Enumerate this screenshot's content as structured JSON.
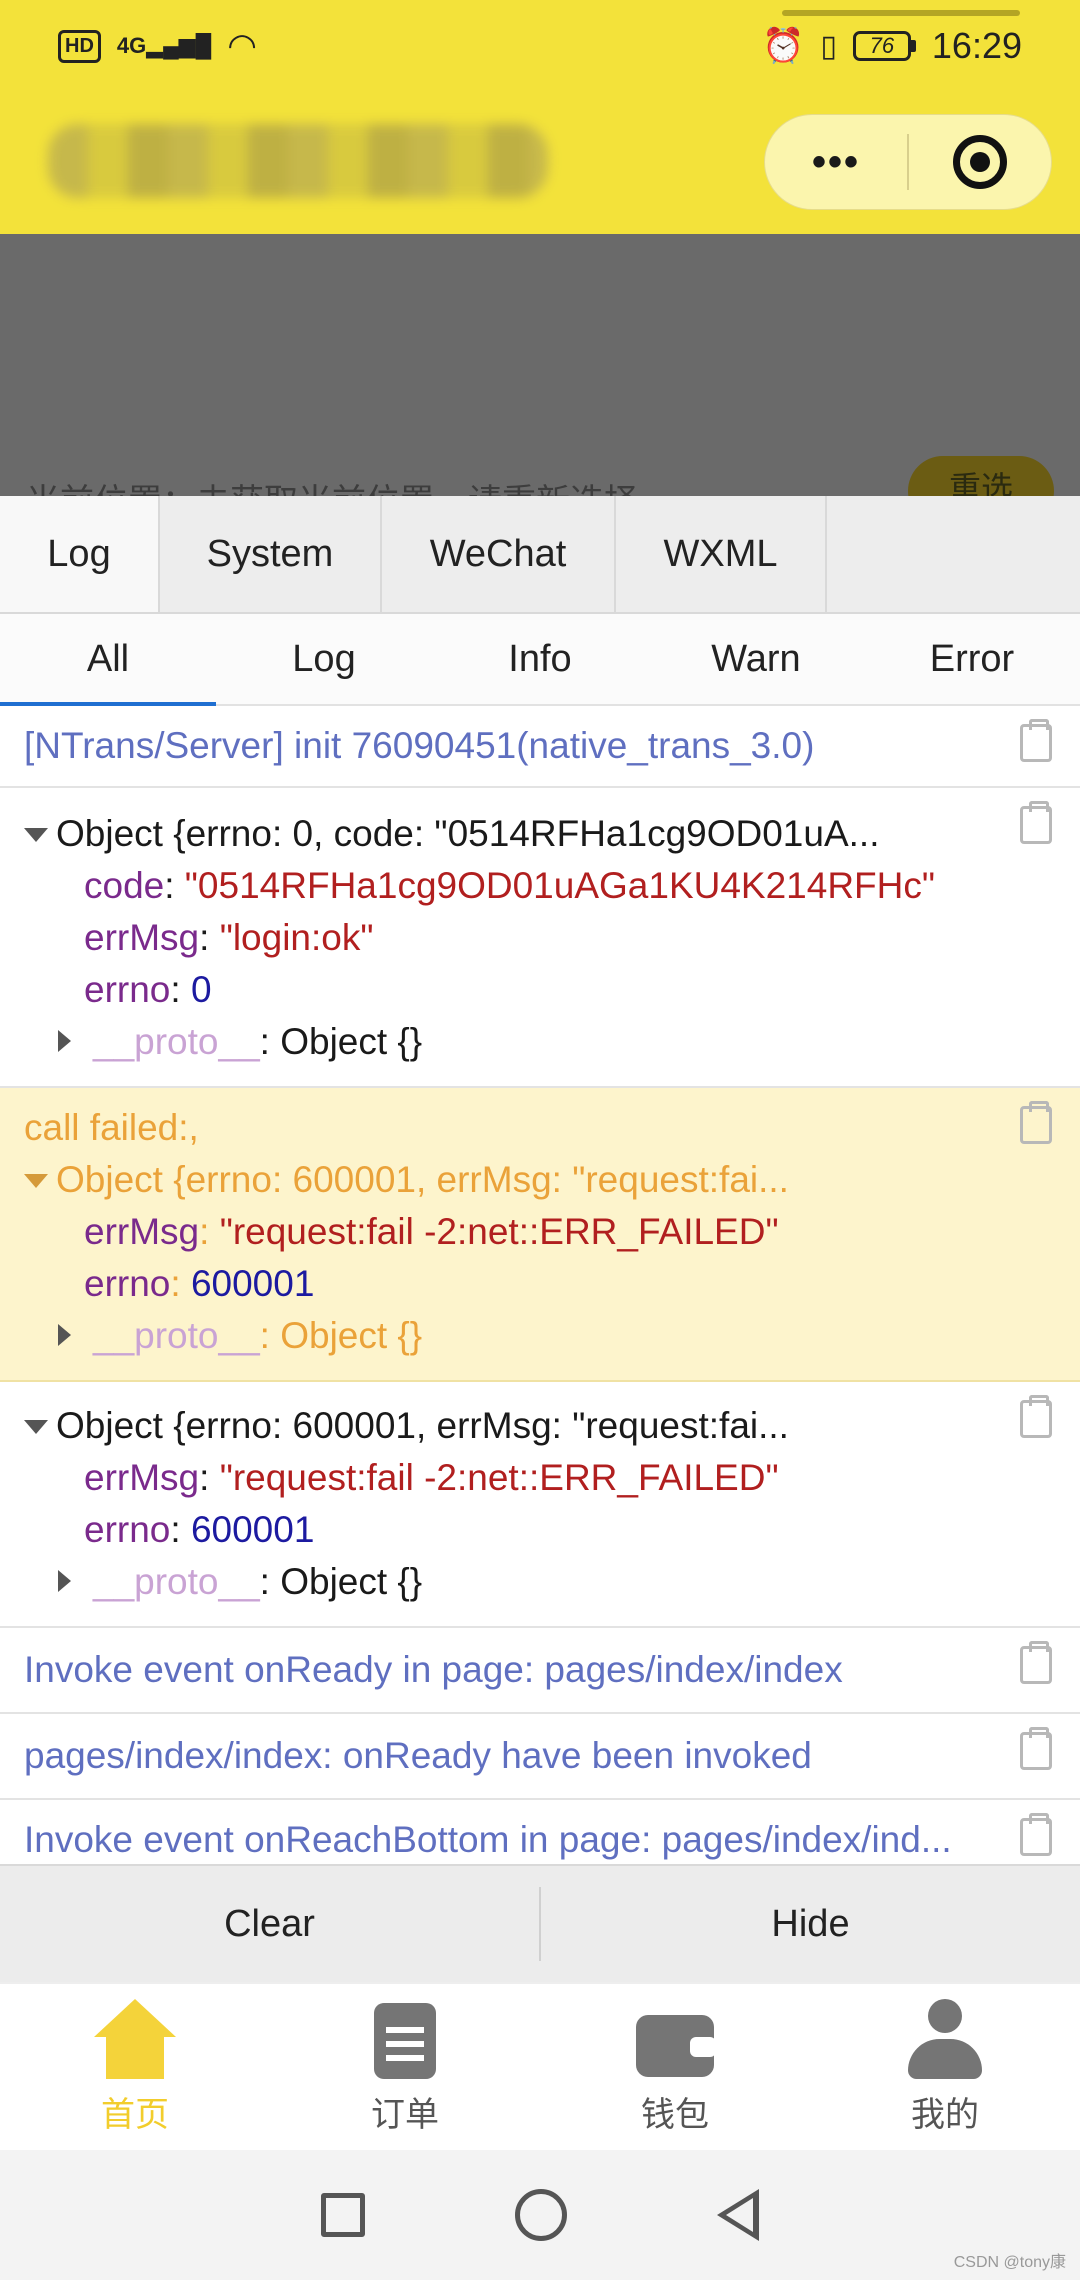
{
  "status_bar": {
    "hd": "HD",
    "network": "4G",
    "battery": "76",
    "time": "16:29"
  },
  "header": {
    "more_label": "•••"
  },
  "page": {
    "location_text": "当前位置：未获取当前位置，请重新选择",
    "reselect_label": "重选"
  },
  "console": {
    "top_tabs": [
      "Log",
      "System",
      "WeChat",
      "WXML"
    ],
    "sub_tabs": [
      "All",
      "Log",
      "Info",
      "Warn",
      "Error"
    ],
    "logs": {
      "row1": "[NTrans/Server] init 76090451(native_trans_3.0)",
      "row2": {
        "summary": "Object {errno: 0, code: \"0514RFHa1cg9OD01uA...",
        "code_key": "code",
        "code_val": "\"0514RFHa1cg9OD01uAGa1KU4K214RFHc\"",
        "errmsg_key": "errMsg",
        "errmsg_val": "\"login:ok\"",
        "errno_key": "errno",
        "errno_val": "0",
        "proto_key": "__proto__",
        "proto_val": "Object {}"
      },
      "row3": {
        "title": "call failed:,",
        "summary": "Object {errno: 600001, errMsg: \"request:fai...",
        "errmsg_key": "errMsg",
        "errmsg_val": "\"request:fail -2:net::ERR_FAILED\"",
        "errno_key": "errno",
        "errno_val": "600001",
        "proto_key": "__proto__",
        "proto_val": "Object {}"
      },
      "row4": {
        "summary": "Object {errno: 600001, errMsg: \"request:fai...",
        "errmsg_key": "errMsg",
        "errmsg_val": "\"request:fail -2:net::ERR_FAILED\"",
        "errno_key": "errno",
        "errno_val": "600001",
        "proto_key": "__proto__",
        "proto_val": "Object {}"
      },
      "row5": "Invoke event onReady in page: pages/index/index",
      "row6": "pages/index/index: onReady have been invoked",
      "row7": "Invoke event onReachBottom in page: pages/index/ind..."
    },
    "clear_label": "Clear",
    "hide_label": "Hide"
  },
  "tabbar": {
    "items": [
      {
        "label": "首页",
        "icon": "home-icon"
      },
      {
        "label": "订单",
        "icon": "order-icon"
      },
      {
        "label": "钱包",
        "icon": "wallet-icon"
      },
      {
        "label": "我的",
        "icon": "user-icon"
      }
    ],
    "active_color": "#f2cd2c"
  },
  "watermark": "CSDN @tony康"
}
